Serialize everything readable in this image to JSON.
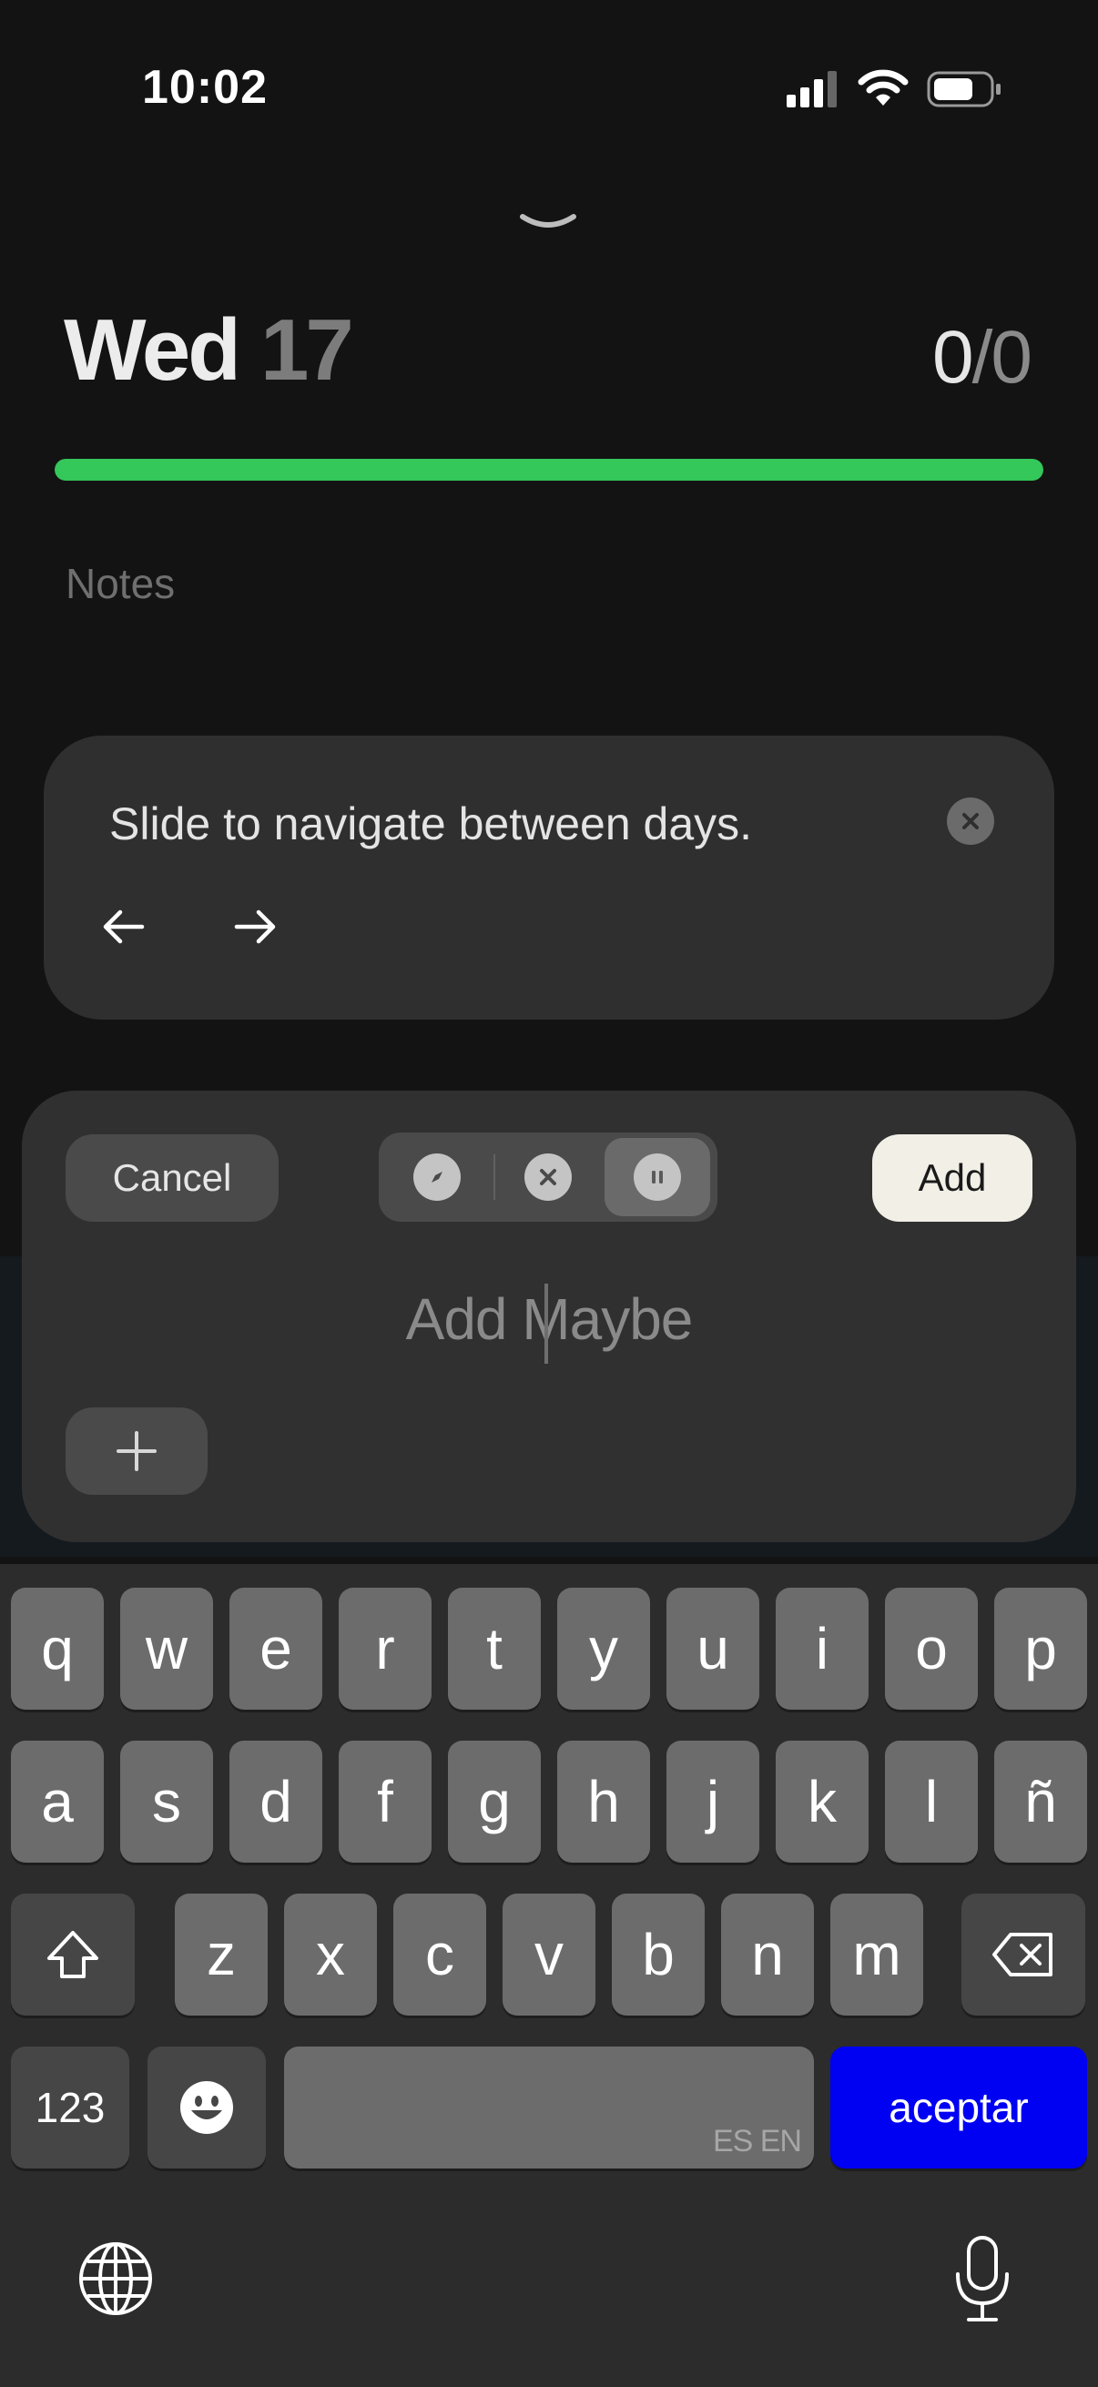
{
  "status_bar": {
    "time": "10:02"
  },
  "header": {
    "day_name": "Wed",
    "day_number": "17",
    "completed": "0",
    "separator": "/",
    "total": "0",
    "progress_fraction": 1.0
  },
  "colors": {
    "progress": "#34c759",
    "accept_key": "#0000f2",
    "add_button": "#f2efe6"
  },
  "notes": {
    "placeholder": "Notes"
  },
  "tip": {
    "text": "Slide to navigate between days.",
    "close_icon": "close-icon",
    "prev_icon": "arrow-left-icon",
    "next_icon": "arrow-right-icon"
  },
  "composer": {
    "cancel_label": "Cancel",
    "add_label": "Add",
    "input_placeholder": "Add Maybe",
    "status_options": [
      {
        "icon": "compass-icon",
        "active": false
      },
      {
        "icon": "x-circle-icon",
        "active": false
      },
      {
        "icon": "pause-circle-icon",
        "active": true
      }
    ]
  },
  "keyboard": {
    "row1": [
      "q",
      "w",
      "e",
      "r",
      "t",
      "y",
      "u",
      "i",
      "o",
      "p"
    ],
    "row2": [
      "a",
      "s",
      "d",
      "f",
      "g",
      "h",
      "j",
      "k",
      "l",
      "ñ"
    ],
    "row3": [
      "z",
      "x",
      "c",
      "v",
      "b",
      "n",
      "m"
    ],
    "numbers_label": "123",
    "space_languages": "ES EN",
    "return_label": "aceptar"
  }
}
